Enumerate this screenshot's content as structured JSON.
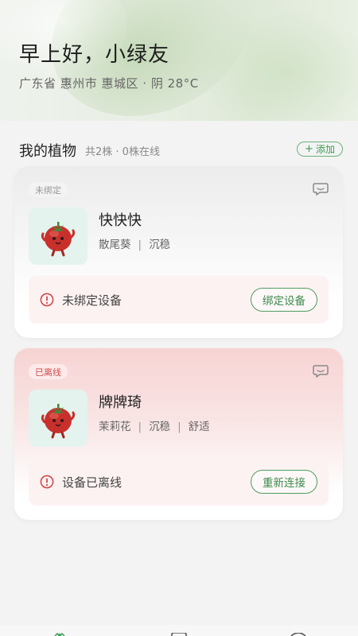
{
  "header": {
    "greeting": "早上好，小绿友",
    "location": "广东省 惠州市 惠城区 · 阴 28°C"
  },
  "plants_section": {
    "title": "我的植物",
    "meta": "共2株 · 0株在线",
    "add_label": "添加",
    "add_icon": "plus-icon"
  },
  "plants": [
    {
      "badge": "未绑定",
      "name": "快快快",
      "tags": [
        "散尾葵",
        "沉稳"
      ],
      "alert_text": "未绑定设备",
      "action_label": "绑定设备"
    },
    {
      "badge": "已离线",
      "name": "牌牌琦",
      "tags": [
        "茉莉花",
        "沉稳",
        "舒适"
      ],
      "alert_text": "设备已离线",
      "action_label": "重新连接"
    }
  ],
  "colors": {
    "accent_green": "#3f9a55",
    "alert_red": "#d24a4a",
    "offline_card": "#f7d3d3"
  },
  "icons": [
    "message-icon",
    "alert-circle-icon",
    "tomato-mascot-icon"
  ]
}
